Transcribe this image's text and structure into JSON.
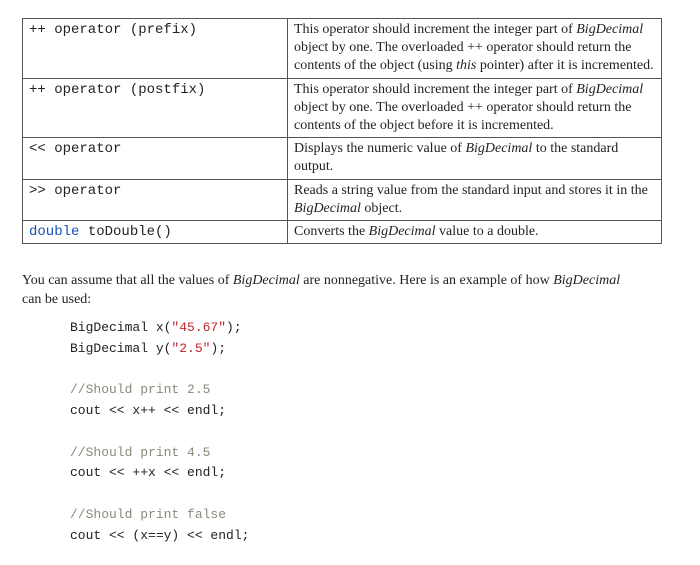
{
  "table": {
    "rows": [
      {
        "label": "++ operator (prefix)",
        "desc_html": "This operator should increment the integer part of <span class='bd'>BigDecimal</span> object by one. The overloaded ++ operator should return the contents of the object (using <span class='th'>this</span> pointer) after it is incremented."
      },
      {
        "label": "++ operator (postfix)",
        "desc_html": "This operator should increment the integer part of <span class='bd'>BigDecimal</span> object by one. The overloaded ++ operator should return the contents of the object before it is incremented."
      },
      {
        "label": "<< operator",
        "desc_html": "Displays the numeric value of <span class='bd'>BigDecimal</span> to the standard output."
      },
      {
        "label": ">> operator",
        "desc_html": "Reads a string value from the standard input and stores it in the <span class='bd'>BigDecimal</span> object."
      },
      {
        "label_html": "<span class='kw'>double</span> toDouble()",
        "desc_html": "Converts the <span class='bd'>BigDecimal</span> value to a double."
      }
    ]
  },
  "prose_html": "You can assume that all the values of <span class='bd'>BigDecimal</span> are nonnegative. Here is an example of how <span class='bd'>BigDecimal</span> can be used:",
  "code": {
    "l1a": "BigDecimal x(",
    "l1b": "\"45.67\"",
    "l1c": ");",
    "l2a": "BigDecimal y(",
    "l2b": "\"2.5\"",
    "l2c": ");",
    "c1": "//Should print 2.5",
    "l3": "cout << x++ << endl;",
    "c2": "//Should print 4.5",
    "l4": "cout << ++x << endl;",
    "c3": "//Should print false",
    "l5": "cout << (x==y) << endl;"
  }
}
